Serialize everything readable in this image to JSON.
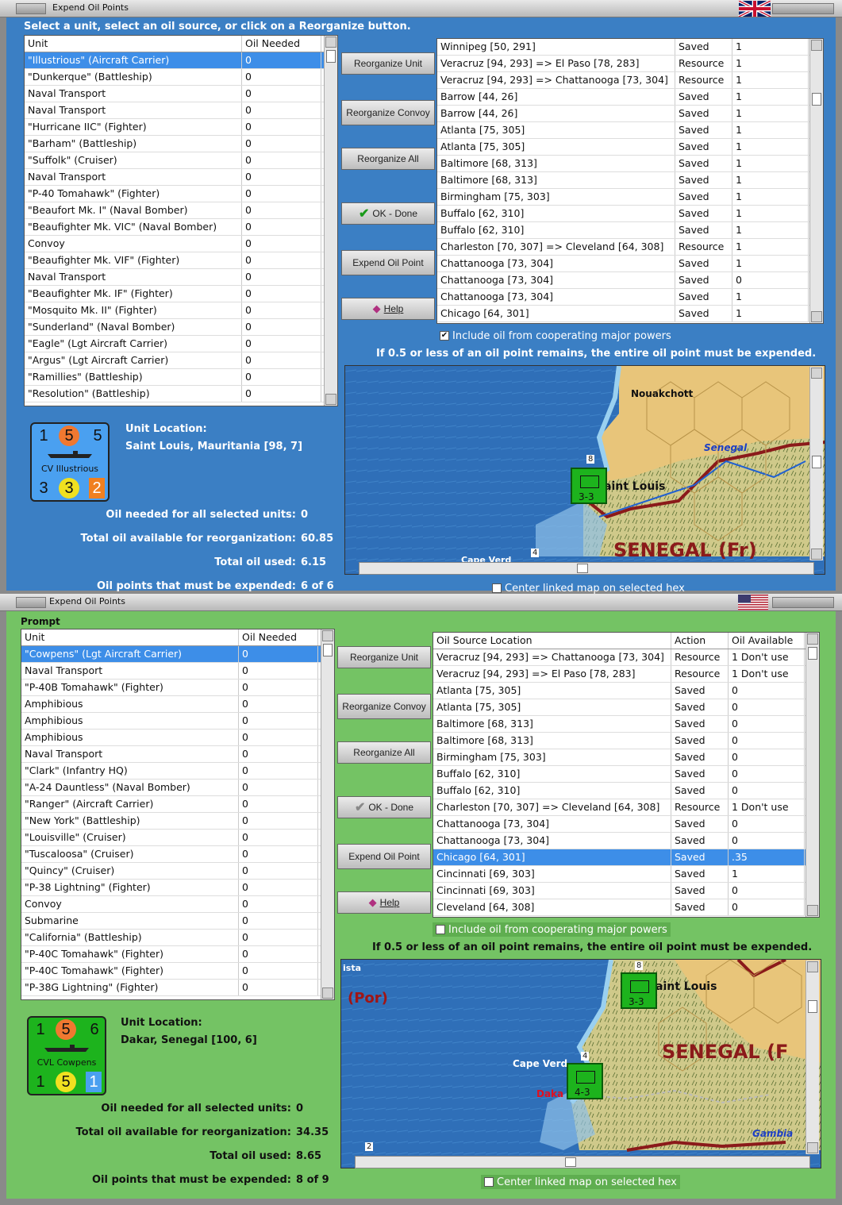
{
  "w1": {
    "title": "Expend Oil Points",
    "prompt": "Select a unit, select an oil source, or click on a Reorganize button.",
    "units_header": [
      "Unit",
      "Oil Needed"
    ],
    "units": [
      [
        "\"Illustrious\" (Aircraft Carrier)",
        "0"
      ],
      [
        "\"Dunkerque\" (Battleship)",
        "0"
      ],
      [
        "Naval Transport",
        "0"
      ],
      [
        "Naval Transport",
        "0"
      ],
      [
        "\"Hurricane IIC\" (Fighter)",
        "0"
      ],
      [
        "\"Barham\" (Battleship)",
        "0"
      ],
      [
        "\"Suffolk\" (Cruiser)",
        "0"
      ],
      [
        "Naval Transport",
        "0"
      ],
      [
        "\"P-40 Tomahawk\" (Fighter)",
        "0"
      ],
      [
        "\"Beaufort Mk. I\" (Naval Bomber)",
        "0"
      ],
      [
        "\"Beaufighter Mk. VIC\" (Naval Bomber)",
        "0"
      ],
      [
        "Convoy",
        "0"
      ],
      [
        "\"Beaufighter Mk. VIF\" (Fighter)",
        "0"
      ],
      [
        "Naval Transport",
        "0"
      ],
      [
        "\"Beaufighter Mk. IF\" (Fighter)",
        "0"
      ],
      [
        "\"Mosquito Mk. II\" (Fighter)",
        "0"
      ],
      [
        "\"Sunderland\" (Naval Bomber)",
        "0"
      ],
      [
        "\"Eagle\" (Lgt Aircraft Carrier)",
        "0"
      ],
      [
        "\"Argus\" (Lgt Aircraft Carrier)",
        "0"
      ],
      [
        "\"Ramillies\" (Battleship)",
        "0"
      ],
      [
        "\"Resolution\" (Battleship)",
        "0"
      ]
    ],
    "sources": [
      [
        "Winnipeg [50, 291]",
        "Saved",
        "1"
      ],
      [
        "Veracruz [94, 293] => El Paso [78, 283]",
        "Resource",
        "1"
      ],
      [
        "Veracruz [94, 293] => Chattanooga [73, 304]",
        "Resource",
        "1"
      ],
      [
        "Barrow [44, 26]",
        "Saved",
        "1"
      ],
      [
        "Barrow [44, 26]",
        "Saved",
        "1"
      ],
      [
        "Atlanta [75, 305]",
        "Saved",
        "1"
      ],
      [
        "Atlanta [75, 305]",
        "Saved",
        "1"
      ],
      [
        "Baltimore [68, 313]",
        "Saved",
        "1"
      ],
      [
        "Baltimore [68, 313]",
        "Saved",
        "1"
      ],
      [
        "Birmingham [75, 303]",
        "Saved",
        "1"
      ],
      [
        "Buffalo [62, 310]",
        "Saved",
        "1"
      ],
      [
        "Buffalo [62, 310]",
        "Saved",
        "1"
      ],
      [
        "Charleston [70, 307] => Cleveland [64, 308]",
        "Resource",
        "1"
      ],
      [
        "Chattanooga [73, 304]",
        "Saved",
        "1"
      ],
      [
        "Chattanooga [73, 304]",
        "Saved",
        "0"
      ],
      [
        "Chattanooga [73, 304]",
        "Saved",
        "1"
      ],
      [
        "Chicago [64, 301]",
        "Saved",
        "1"
      ]
    ],
    "buttons": {
      "reorg_unit": "Reorganize Unit",
      "reorg_convoy": "Reorganize Convoy",
      "reorg_all": "Reorganize All",
      "ok": "OK - Done",
      "expend": "Expend Oil Point",
      "help": "Help"
    },
    "include_label": "Include oil from cooperating major powers",
    "note": "If 0.5 or less of an oil point remains, the entire oil point must be expended.",
    "counter": {
      "tl": "1",
      "tm": "5",
      "tr": "5",
      "bl": "3",
      "bm": "3",
      "br": "2",
      "name": "CV Illustrious"
    },
    "loc_label": "Unit Location:",
    "loc_value": "Saint Louis, Mauritania [98, 7]",
    "stats": [
      [
        "Oil needed for all selected units:",
        "0"
      ],
      [
        "Total oil available for reorganization:",
        "60.85"
      ],
      [
        "Total oil used:",
        "6.15"
      ],
      [
        "Oil points that must be expended:",
        "6 of 6"
      ]
    ],
    "center_label": "Center linked map on selected hex",
    "map": {
      "nouakchott": "Nouakchott",
      "senegal_river": "Senegal",
      "saint_louis": "aint Louis",
      "country": "SENEGAL (Fr)",
      "cape": "Cape Verd",
      "unit_top": "8",
      "unit_code": "3-3",
      "unit_small": "4"
    }
  },
  "w2": {
    "title": "Expend Oil Points",
    "prompt": "Prompt",
    "units_header": [
      "Unit",
      "Oil Needed"
    ],
    "units": [
      [
        "\"Cowpens\" (Lgt Aircraft Carrier)",
        "0"
      ],
      [
        "Naval Transport",
        "0"
      ],
      [
        "\"P-40B Tomahawk\" (Fighter)",
        "0"
      ],
      [
        "Amphibious",
        "0"
      ],
      [
        "Amphibious",
        "0"
      ],
      [
        "Amphibious",
        "0"
      ],
      [
        "Naval Transport",
        "0"
      ],
      [
        "\"Clark\" (Infantry HQ)",
        "0"
      ],
      [
        "\"A-24 Dauntless\" (Naval Bomber)",
        "0"
      ],
      [
        "\"Ranger\" (Aircraft Carrier)",
        "0"
      ],
      [
        "\"New York\" (Battleship)",
        "0"
      ],
      [
        "\"Louisville\" (Cruiser)",
        "0"
      ],
      [
        "\"Tuscaloosa\" (Cruiser)",
        "0"
      ],
      [
        "\"Quincy\" (Cruiser)",
        "0"
      ],
      [
        "\"P-38 Lightning\" (Fighter)",
        "0"
      ],
      [
        "Convoy",
        "0"
      ],
      [
        "Submarine",
        "0"
      ],
      [
        "\"California\" (Battleship)",
        "0"
      ],
      [
        "\"P-40C Tomahawk\" (Fighter)",
        "0"
      ],
      [
        "\"P-40C Tomahawk\" (Fighter)",
        "0"
      ],
      [
        "\"P-38G Lightning\" (Fighter)",
        "0"
      ]
    ],
    "sources_header": [
      "Oil Source Location",
      "Action",
      "Oil Available"
    ],
    "sources": [
      [
        "Veracruz [94, 293] => Chattanooga [73, 304]",
        "Resource",
        "1 Don't use"
      ],
      [
        "Veracruz [94, 293] => El Paso [78, 283]",
        "Resource",
        "1 Don't use"
      ],
      [
        "Atlanta [75, 305]",
        "Saved",
        "0"
      ],
      [
        "Atlanta [75, 305]",
        "Saved",
        "0"
      ],
      [
        "Baltimore [68, 313]",
        "Saved",
        "0"
      ],
      [
        "Baltimore [68, 313]",
        "Saved",
        "0"
      ],
      [
        "Birmingham [75, 303]",
        "Saved",
        "0"
      ],
      [
        "Buffalo [62, 310]",
        "Saved",
        "0"
      ],
      [
        "Buffalo [62, 310]",
        "Saved",
        "0"
      ],
      [
        "Charleston [70, 307] => Cleveland [64, 308]",
        "Resource",
        "1 Don't use"
      ],
      [
        "Chattanooga [73, 304]",
        "Saved",
        "0"
      ],
      [
        "Chattanooga [73, 304]",
        "Saved",
        "0"
      ],
      [
        "Chicago [64, 301]",
        "Saved",
        ".35"
      ],
      [
        "Cincinnati [69, 303]",
        "Saved",
        "1"
      ],
      [
        "Cincinnati [69, 303]",
        "Saved",
        "0"
      ],
      [
        "Cleveland [64, 308]",
        "Saved",
        "0"
      ]
    ],
    "buttons": {
      "reorg_unit": "Reorganize Unit",
      "reorg_convoy": "Reorganize Convoy",
      "reorg_all": "Reorganize All",
      "ok": "OK - Done",
      "expend": "Expend Oil Point",
      "help": "Help"
    },
    "include_label": "Include oil from cooperating major powers",
    "note": "If 0.5 or less of an oil point remains, the entire oil point must be expended.",
    "counter": {
      "tl": "1",
      "tm": "5",
      "tr": "6",
      "bl": "1",
      "bm": "5",
      "br": "1",
      "name": "CVL Cowpens"
    },
    "loc_label": "Unit Location:",
    "loc_value": "Dakar, Senegal [100, 6]",
    "stats": [
      [
        "Oil needed for all selected units:",
        "0"
      ],
      [
        "Total oil available for reorganization:",
        "34.35"
      ],
      [
        "Total oil used:",
        "8.65"
      ],
      [
        "Oil points that must be expended:",
        "8 of 9"
      ]
    ],
    "center_label": "Center linked map on selected hex",
    "map": {
      "ista": "ista",
      "por": "(Por)",
      "saint_louis": "aint Louis",
      "country": "SENEGAL (F",
      "cape": "Cape Verd",
      "dakar": "Daka",
      "gambia": "Gambia",
      "unit_top": "8",
      "unit_code": "3-3",
      "unit2_top": "4",
      "unit2_code": "4-3",
      "small": "2"
    }
  },
  "colors": {
    "blue_bg": "#3b7fc4",
    "green_bg": "#74c364",
    "select": "#3d8ee8",
    "land": "#e8c57a",
    "border": "#8b1a1a",
    "unit": "#1db31d"
  }
}
